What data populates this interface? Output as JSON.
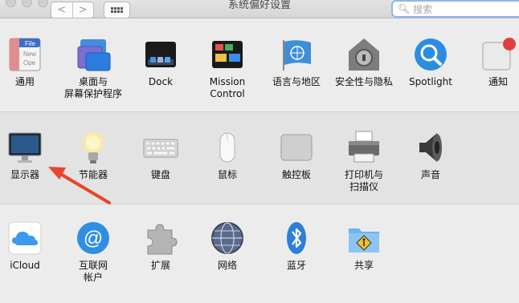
{
  "window": {
    "title": "系统偏好设置"
  },
  "toolbar": {
    "back_glyph": "<",
    "forward_glyph": ">",
    "search_placeholder": "搜索"
  },
  "sections": {
    "personal": [
      {
        "label": "通用",
        "icon": "general-icon"
      },
      {
        "label": "桌面与\n屏幕保护程序",
        "icon": "desktop-screensaver-icon"
      },
      {
        "label": "Dock",
        "icon": "dock-icon"
      },
      {
        "label": "Mission\nControl",
        "icon": "mission-control-icon"
      },
      {
        "label": "语言与地区",
        "icon": "language-region-icon"
      },
      {
        "label": "安全性与隐私",
        "icon": "security-privacy-icon"
      },
      {
        "label": "Spotlight",
        "icon": "spotlight-icon"
      },
      {
        "label": "通知",
        "icon": "notifications-icon"
      }
    ],
    "hardware": [
      {
        "label": "显示器",
        "icon": "displays-icon"
      },
      {
        "label": "节能器",
        "icon": "energy-saver-icon"
      },
      {
        "label": "键盘",
        "icon": "keyboard-icon"
      },
      {
        "label": "鼠标",
        "icon": "mouse-icon"
      },
      {
        "label": "触控板",
        "icon": "trackpad-icon"
      },
      {
        "label": "打印机与\n扫描仪",
        "icon": "printers-scanners-icon"
      },
      {
        "label": "声音",
        "icon": "sound-icon"
      }
    ],
    "internet": [
      {
        "label": "iCloud",
        "icon": "icloud-icon"
      },
      {
        "label": "互联网\n帐户",
        "icon": "internet-accounts-icon"
      },
      {
        "label": "扩展",
        "icon": "extensions-icon"
      },
      {
        "label": "网络",
        "icon": "network-icon"
      },
      {
        "label": "蓝牙",
        "icon": "bluetooth-icon"
      },
      {
        "label": "共享",
        "icon": "sharing-icon"
      }
    ]
  },
  "general_icon_text": [
    "File",
    "New",
    "Ope"
  ],
  "colors": {
    "annotation_arrow": "#e8452c",
    "search_focus": "#8fb6e8"
  }
}
